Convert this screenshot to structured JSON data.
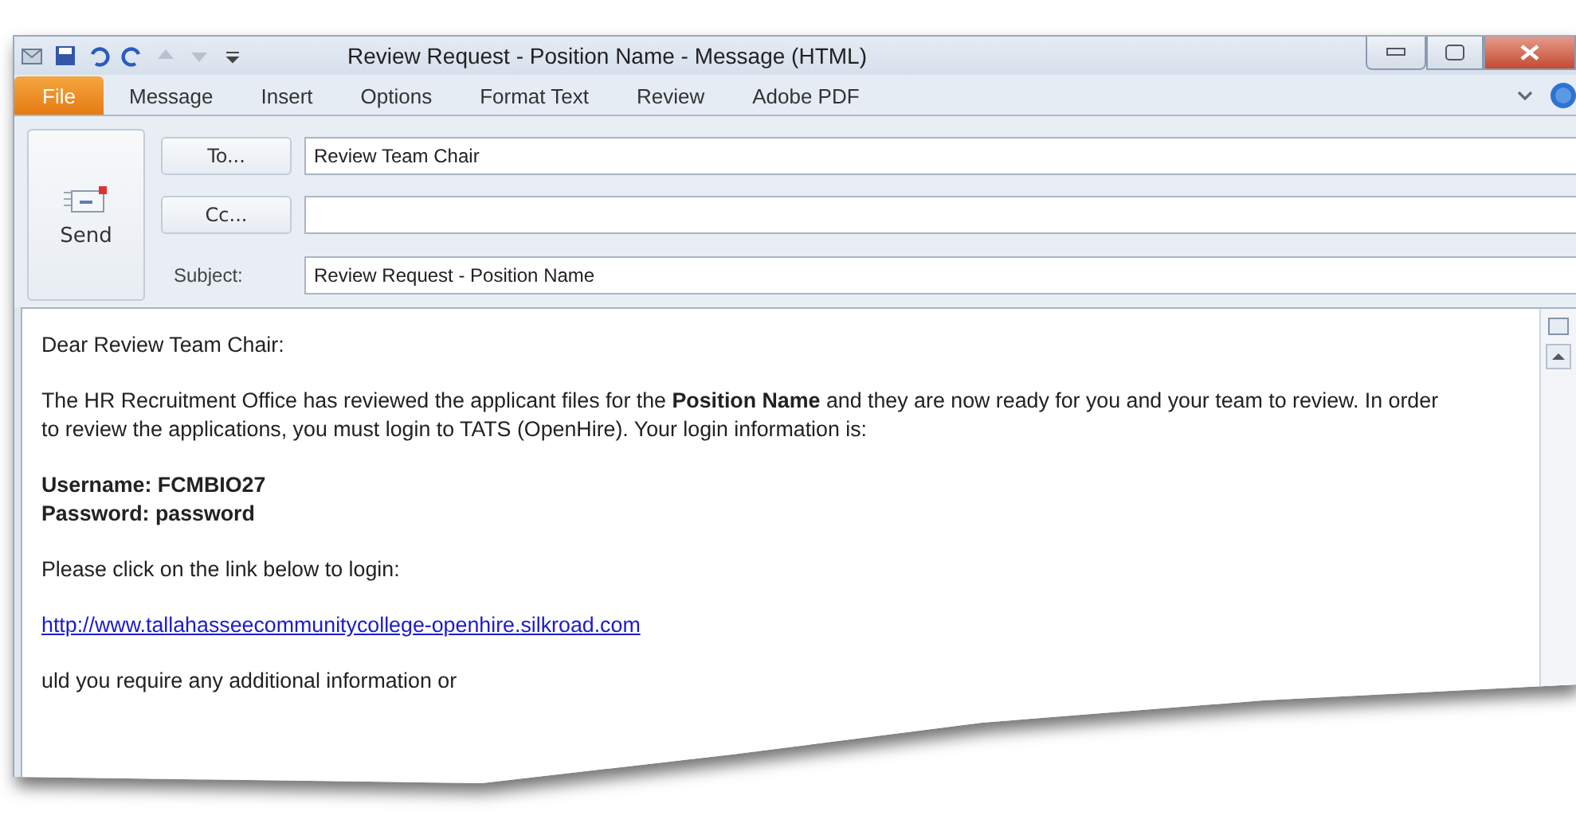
{
  "window": {
    "title": "Review Request - Position Name  -  Message (HTML)"
  },
  "ribbon_tabs": [
    {
      "label": "File",
      "kind": "backstage"
    },
    {
      "label": "Message",
      "kind": "tab"
    },
    {
      "label": "Insert",
      "kind": "tab"
    },
    {
      "label": "Options",
      "kind": "tab"
    },
    {
      "label": "Format Text",
      "kind": "tab"
    },
    {
      "label": "Review",
      "kind": "tab"
    },
    {
      "label": "Adobe PDF",
      "kind": "tab"
    }
  ],
  "header": {
    "send_label": "Send",
    "to_button": "To...",
    "to_value": "Review Team Chair",
    "cc_button": "Cc...",
    "subject_label": "Subject:",
    "subject_value": "Review Request - Position Name"
  },
  "body": [
    {
      "kind": "text",
      "text": "Dear Review Team Chair:"
    },
    {
      "kind": "text",
      "text": "The HR Recruitment Office has reviewed the applicant files for the **Position Name** and they are now ready for you and your team to review.  In order to review the applications, you must login to TATS (OpenHire).  Your login information is:"
    },
    {
      "kind": "bold",
      "lines": [
        "Username:  FCMBIO27",
        "Password:   password"
      ]
    },
    {
      "kind": "text",
      "text": "Please click on the link below to login:"
    },
    {
      "kind": "link",
      "text": "http://www.tallahasseecommunitycollege-openhire.silkroad.com"
    },
    {
      "kind": "text",
      "text": "uld you require any additional information or"
    }
  ]
}
